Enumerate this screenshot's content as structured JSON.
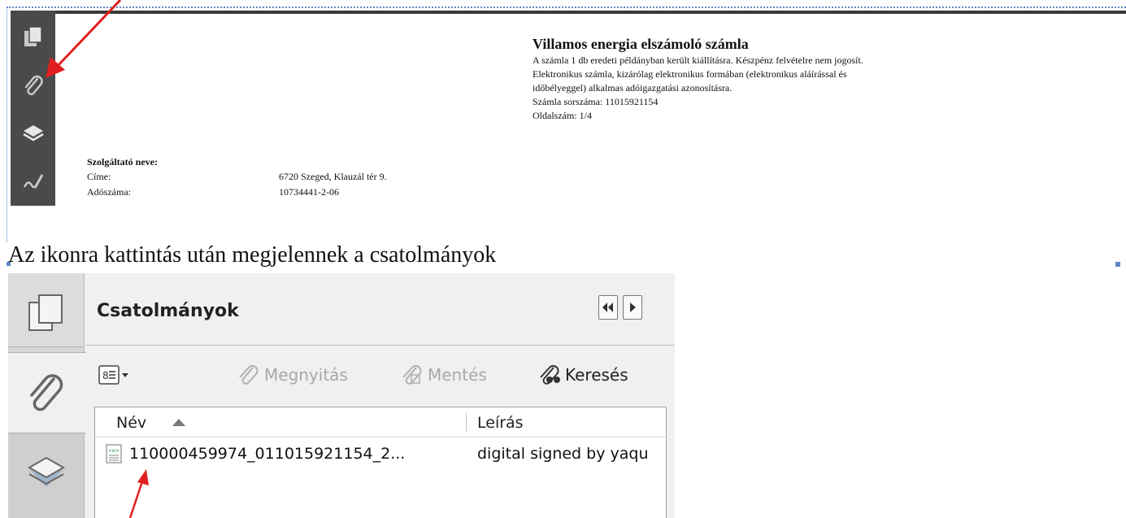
{
  "top_screenshot": {
    "sidebar_icons": [
      "pages-icon",
      "paperclip-icon",
      "layers-icon",
      "signature-icon"
    ],
    "invoice": {
      "title": "Villamos energia elszámoló számla",
      "lines": [
        "A számla 1 db eredeti példányban került kiállításra.   Készpénz felvételre nem jogosít.",
        "Elektronikus számla, kizárólag elektronikus formában (elektronikus aláírással és",
        "időbélyeggel) alkalmas adóigazgatási azonosításra.",
        "Számla sorszáma: 11015921154",
        "Oldalszám: 1/4"
      ]
    },
    "provider": {
      "name_label": "Szolgáltató neve:",
      "address_label": "Címe:",
      "address_value": "6720 Szeged, Klauzál tér 9.",
      "tax_label": "Adószáma:",
      "tax_value": "10734441-2-06"
    }
  },
  "caption": "Az ikonra kattintás után megjelennek a csatolmányok",
  "attachments_panel": {
    "title": "Csatolmányok",
    "nav_tabs": [
      "pages-icon",
      "paperclip-icon",
      "layers-icon"
    ],
    "toolbar": {
      "open_label": "Megnyitás",
      "save_label": "Mentés",
      "search_label": "Keresés"
    },
    "table": {
      "columns": [
        "Név",
        "Leírás"
      ],
      "rows": [
        {
          "name": "110000459974_011015921154_2...",
          "description": "digital signed by yaqu"
        }
      ]
    }
  },
  "colors": {
    "annotation_arrow": "#e02020",
    "selection_border": "#5f86c6",
    "dark_sidebar": "#4a4a4a"
  }
}
